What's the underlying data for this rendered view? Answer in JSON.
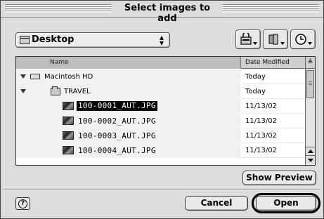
{
  "window": {
    "title": "Select images to add"
  },
  "location": {
    "label": "Desktop"
  },
  "toolbar": {
    "icons": [
      "drive-icon",
      "shortcut-icon",
      "recent-clock-icon"
    ]
  },
  "list": {
    "columns": {
      "name": "Name",
      "date": "Date Modified"
    },
    "rows": [
      {
        "name": "Macintosh HD",
        "date": "Today",
        "kind": "drive",
        "expanded": true
      },
      {
        "name": "TRAVEL",
        "date": "Today",
        "kind": "folder",
        "expanded": true
      },
      {
        "name": "100-0001_AUT.JPG",
        "date": "11/13/02",
        "kind": "image",
        "selected": true
      },
      {
        "name": "100-0002_AUT.JPG",
        "date": "11/13/02",
        "kind": "image"
      },
      {
        "name": "100-0003_AUT.JPG",
        "date": "11/13/02",
        "kind": "image"
      },
      {
        "name": "100-0004_AUT.JPG",
        "date": "11/13/02",
        "kind": "image"
      }
    ]
  },
  "buttons": {
    "show_preview": "Show Preview",
    "cancel": "Cancel",
    "open": "Open",
    "help": "?"
  }
}
